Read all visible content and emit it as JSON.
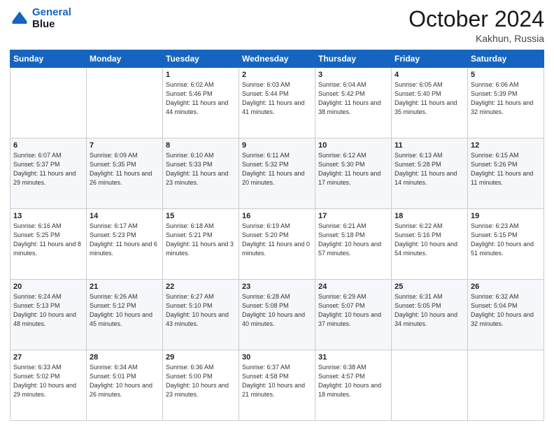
{
  "header": {
    "logo_line1": "General",
    "logo_line2": "Blue",
    "month": "October 2024",
    "location": "Kakhun, Russia"
  },
  "weekdays": [
    "Sunday",
    "Monday",
    "Tuesday",
    "Wednesday",
    "Thursday",
    "Friday",
    "Saturday"
  ],
  "weeks": [
    [
      {
        "day": "",
        "info": ""
      },
      {
        "day": "",
        "info": ""
      },
      {
        "day": "1",
        "info": "Sunrise: 6:02 AM\nSunset: 5:46 PM\nDaylight: 11 hours and 44 minutes."
      },
      {
        "day": "2",
        "info": "Sunrise: 6:03 AM\nSunset: 5:44 PM\nDaylight: 11 hours and 41 minutes."
      },
      {
        "day": "3",
        "info": "Sunrise: 6:04 AM\nSunset: 5:42 PM\nDaylight: 11 hours and 38 minutes."
      },
      {
        "day": "4",
        "info": "Sunrise: 6:05 AM\nSunset: 5:40 PM\nDaylight: 11 hours and 35 minutes."
      },
      {
        "day": "5",
        "info": "Sunrise: 6:06 AM\nSunset: 5:39 PM\nDaylight: 11 hours and 32 minutes."
      }
    ],
    [
      {
        "day": "6",
        "info": "Sunrise: 6:07 AM\nSunset: 5:37 PM\nDaylight: 11 hours and 29 minutes."
      },
      {
        "day": "7",
        "info": "Sunrise: 6:09 AM\nSunset: 5:35 PM\nDaylight: 11 hours and 26 minutes."
      },
      {
        "day": "8",
        "info": "Sunrise: 6:10 AM\nSunset: 5:33 PM\nDaylight: 11 hours and 23 minutes."
      },
      {
        "day": "9",
        "info": "Sunrise: 6:11 AM\nSunset: 5:32 PM\nDaylight: 11 hours and 20 minutes."
      },
      {
        "day": "10",
        "info": "Sunrise: 6:12 AM\nSunset: 5:30 PM\nDaylight: 11 hours and 17 minutes."
      },
      {
        "day": "11",
        "info": "Sunrise: 6:13 AM\nSunset: 5:28 PM\nDaylight: 11 hours and 14 minutes."
      },
      {
        "day": "12",
        "info": "Sunrise: 6:15 AM\nSunset: 5:26 PM\nDaylight: 11 hours and 11 minutes."
      }
    ],
    [
      {
        "day": "13",
        "info": "Sunrise: 6:16 AM\nSunset: 5:25 PM\nDaylight: 11 hours and 8 minutes."
      },
      {
        "day": "14",
        "info": "Sunrise: 6:17 AM\nSunset: 5:23 PM\nDaylight: 11 hours and 6 minutes."
      },
      {
        "day": "15",
        "info": "Sunrise: 6:18 AM\nSunset: 5:21 PM\nDaylight: 11 hours and 3 minutes."
      },
      {
        "day": "16",
        "info": "Sunrise: 6:19 AM\nSunset: 5:20 PM\nDaylight: 11 hours and 0 minutes."
      },
      {
        "day": "17",
        "info": "Sunrise: 6:21 AM\nSunset: 5:18 PM\nDaylight: 10 hours and 57 minutes."
      },
      {
        "day": "18",
        "info": "Sunrise: 6:22 AM\nSunset: 5:16 PM\nDaylight: 10 hours and 54 minutes."
      },
      {
        "day": "19",
        "info": "Sunrise: 6:23 AM\nSunset: 5:15 PM\nDaylight: 10 hours and 51 minutes."
      }
    ],
    [
      {
        "day": "20",
        "info": "Sunrise: 6:24 AM\nSunset: 5:13 PM\nDaylight: 10 hours and 48 minutes."
      },
      {
        "day": "21",
        "info": "Sunrise: 6:26 AM\nSunset: 5:12 PM\nDaylight: 10 hours and 45 minutes."
      },
      {
        "day": "22",
        "info": "Sunrise: 6:27 AM\nSunset: 5:10 PM\nDaylight: 10 hours and 43 minutes."
      },
      {
        "day": "23",
        "info": "Sunrise: 6:28 AM\nSunset: 5:08 PM\nDaylight: 10 hours and 40 minutes."
      },
      {
        "day": "24",
        "info": "Sunrise: 6:29 AM\nSunset: 5:07 PM\nDaylight: 10 hours and 37 minutes."
      },
      {
        "day": "25",
        "info": "Sunrise: 6:31 AM\nSunset: 5:05 PM\nDaylight: 10 hours and 34 minutes."
      },
      {
        "day": "26",
        "info": "Sunrise: 6:32 AM\nSunset: 5:04 PM\nDaylight: 10 hours and 32 minutes."
      }
    ],
    [
      {
        "day": "27",
        "info": "Sunrise: 6:33 AM\nSunset: 5:02 PM\nDaylight: 10 hours and 29 minutes."
      },
      {
        "day": "28",
        "info": "Sunrise: 6:34 AM\nSunset: 5:01 PM\nDaylight: 10 hours and 26 minutes."
      },
      {
        "day": "29",
        "info": "Sunrise: 6:36 AM\nSunset: 5:00 PM\nDaylight: 10 hours and 23 minutes."
      },
      {
        "day": "30",
        "info": "Sunrise: 6:37 AM\nSunset: 4:58 PM\nDaylight: 10 hours and 21 minutes."
      },
      {
        "day": "31",
        "info": "Sunrise: 6:38 AM\nSunset: 4:57 PM\nDaylight: 10 hours and 18 minutes."
      },
      {
        "day": "",
        "info": ""
      },
      {
        "day": "",
        "info": ""
      }
    ]
  ]
}
